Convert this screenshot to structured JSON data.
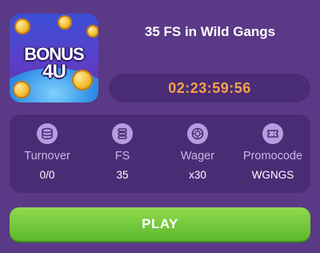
{
  "promo": {
    "logo_line1": "BONUS",
    "logo_line2": "4U",
    "title": "35 FS in Wild Gangs",
    "timer": "02:23:59:56"
  },
  "stats": [
    {
      "label": "Turnover",
      "value": "0/0",
      "icon": "coins-stack-icon"
    },
    {
      "label": "FS",
      "value": "35",
      "icon": "chips-stack-icon"
    },
    {
      "label": "Wager",
      "value": "x30",
      "icon": "casino-chip-icon"
    },
    {
      "label": "Promocode",
      "value": "WGNGS",
      "icon": "ticket-icon"
    }
  ],
  "play_button": {
    "label": "PLAY"
  },
  "colors": {
    "background": "#5a3a86",
    "panel": "#4a2c74",
    "timer_text": "#f3a24a",
    "button": "#6fc63a",
    "label_text": "#c9b8e8"
  }
}
